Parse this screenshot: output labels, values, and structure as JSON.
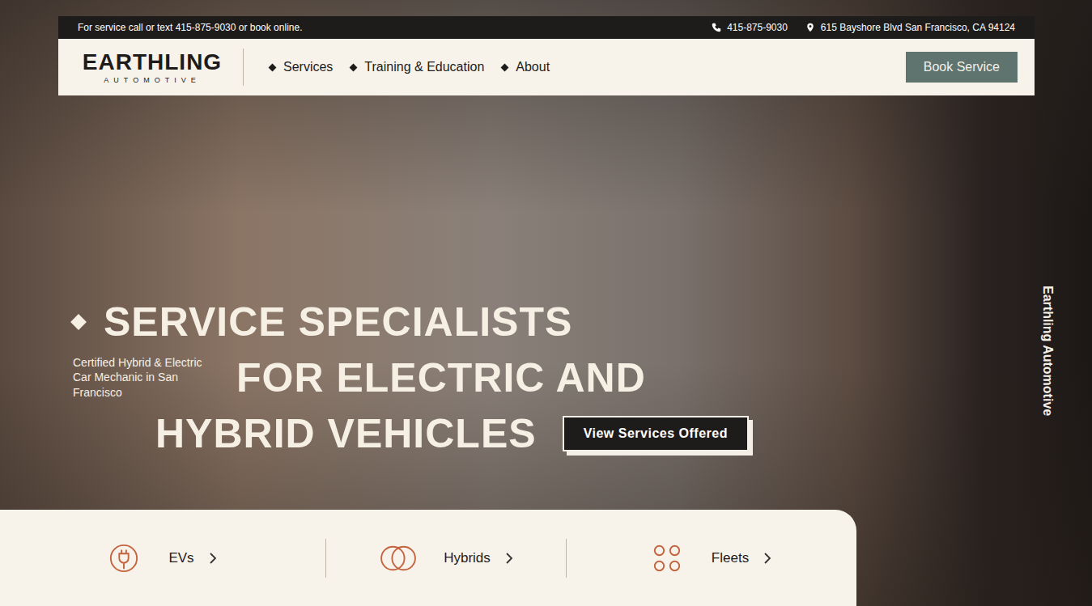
{
  "topbar": {
    "message": "For service call or text 415-875-9030 or book online.",
    "phone": "415-875-9030",
    "address": "615 Bayshore Blvd San Francisco, CA 94124"
  },
  "logo": {
    "name": "EARTHLING",
    "subtitle": "AUTOMOTIVE"
  },
  "nav": {
    "items": [
      {
        "label": "Services"
      },
      {
        "label": "Training & Education"
      },
      {
        "label": "About"
      }
    ],
    "button": "Book Service"
  },
  "hero": {
    "line1": "SERVICE SPECIALISTS",
    "line2": "FOR ELECTRIC AND",
    "line3": "HYBRID VEHICLES",
    "subtitle": "Certified Hybrid & Electric Car Mechanic in San Francisco",
    "cta": "View Services Offered",
    "side": "Earthling Automotive"
  },
  "categories": [
    {
      "label": "EVs"
    },
    {
      "label": "Hybrids"
    },
    {
      "label": "Fleets"
    }
  ]
}
